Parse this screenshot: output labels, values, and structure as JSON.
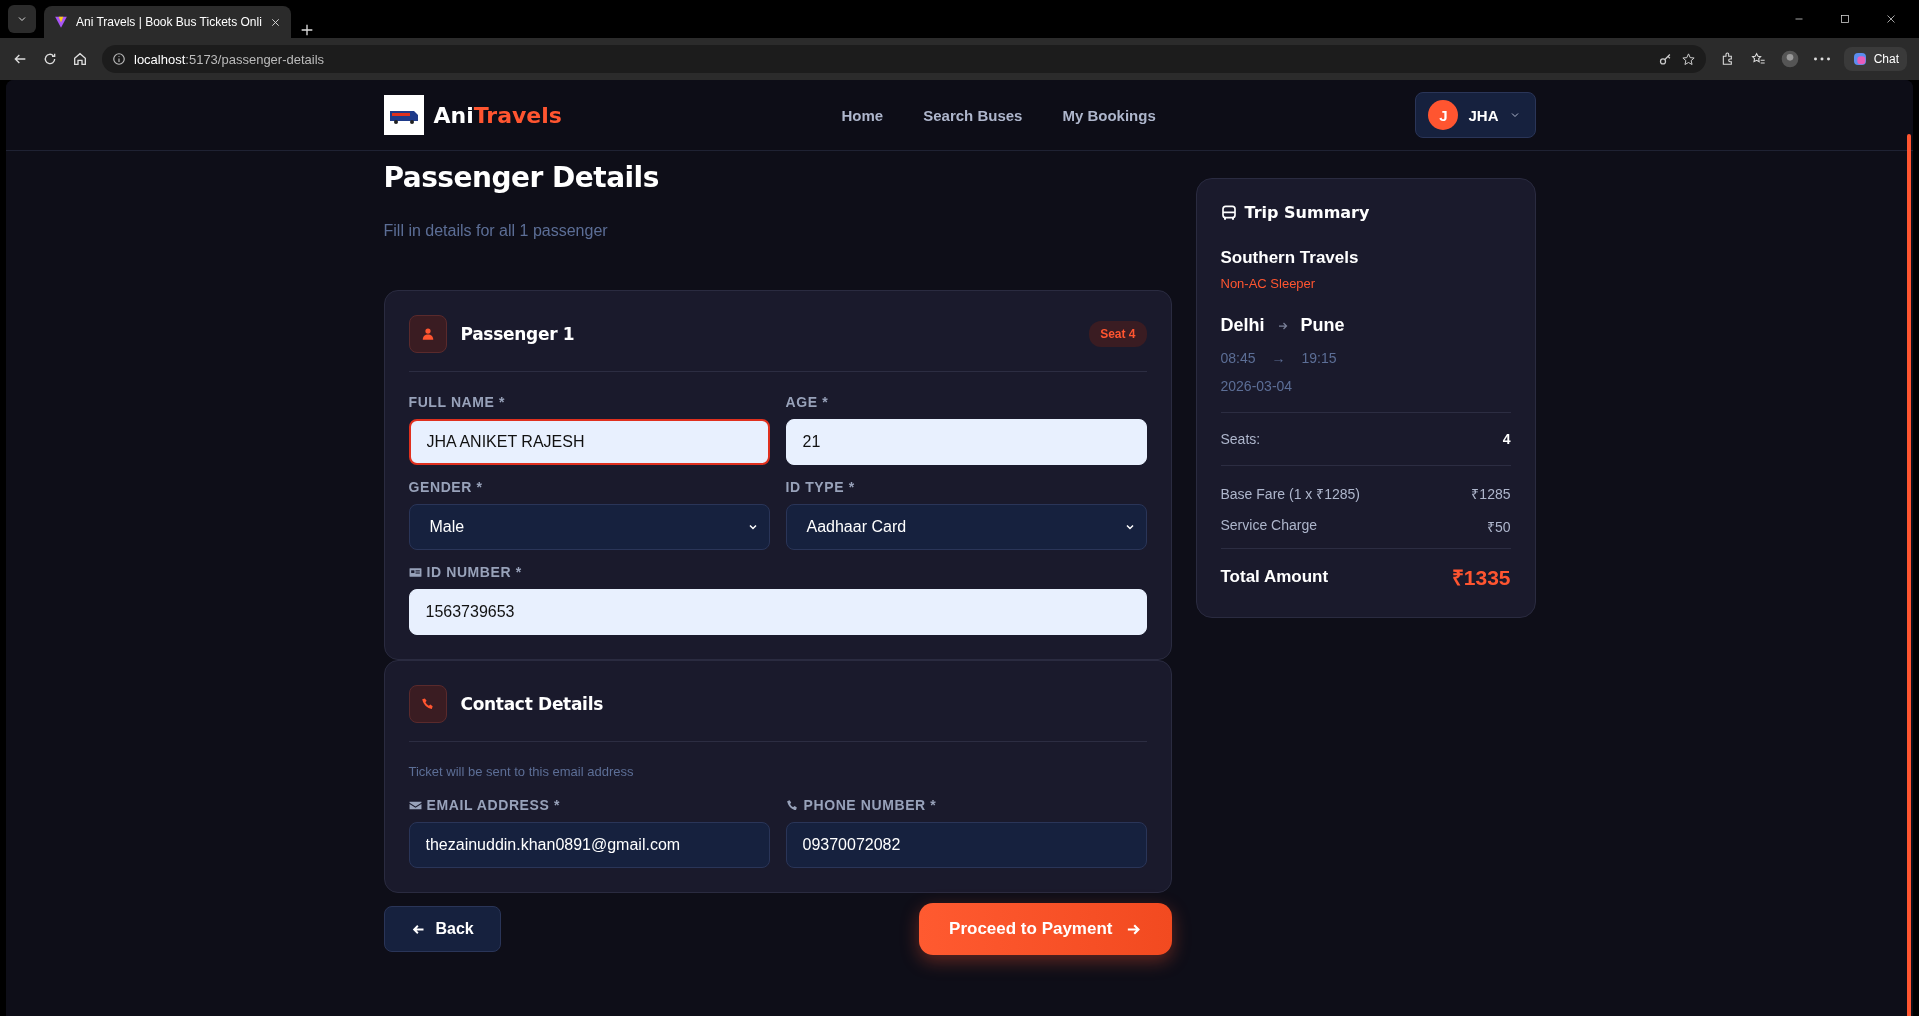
{
  "browser": {
    "tab_title": "Ani Travels | Book Bus Tickets Onli",
    "url_host": "localhost",
    "url_path": ":5173/passenger-details",
    "chat_label": "Chat"
  },
  "header": {
    "brand": "Ani",
    "brand_accent": "Travels",
    "nav": [
      {
        "label": "Home"
      },
      {
        "label": "Search Buses"
      },
      {
        "label": "My Bookings"
      }
    ],
    "user": {
      "initial": "J",
      "name": "JHA"
    }
  },
  "page": {
    "title": "Passenger Details",
    "subtitle": "Fill in details for all 1 passenger"
  },
  "passenger": {
    "title": "Passenger 1",
    "seat_badge": "Seat 4",
    "fields": [
      {
        "kind": "text",
        "label": "FULL NAME *",
        "value": "JHA ANIKET RAJESH",
        "focused": true
      },
      {
        "kind": "text",
        "label": "AGE *",
        "value": "21",
        "focused": false
      },
      {
        "kind": "select",
        "label": "GENDER *",
        "value": "Male",
        "focused": false
      },
      {
        "kind": "select",
        "label": "ID TYPE *",
        "value": "Aadhaar Card",
        "focused": false
      },
      {
        "kind": "id-number",
        "label": "ID NUMBER *",
        "value": "1563739653",
        "focused": false
      }
    ]
  },
  "contact": {
    "title": "Contact Details",
    "note": "Ticket will be sent to this email address",
    "fields": [
      {
        "kind": "email",
        "label": "EMAIL ADDRESS *",
        "value": "thezainuddin.khan0891@gmail.com",
        "focused": false
      },
      {
        "kind": "phone",
        "label": "PHONE NUMBER *",
        "value": "09370072082",
        "focused": false
      }
    ]
  },
  "summary": {
    "title": "Trip Summary",
    "operator": "Southern Travels",
    "bus_type": "Non-AC Sleeper",
    "from": "Delhi",
    "to": "Pune",
    "depart": "08:45",
    "arrow": "→",
    "arrive": "19:15",
    "date": "2026-03-04",
    "seats_label": "Seats:",
    "seats_value": "4",
    "fares": [
      {
        "label": "Base Fare (1 x ₹1285)",
        "value": "₹1285"
      },
      {
        "label": "Service Charge",
        "value": "₹50"
      }
    ],
    "total_label": "Total Amount",
    "total_value": "₹1335"
  },
  "buttons": {
    "back": "Back",
    "proceed": "Proceed to Payment"
  }
}
